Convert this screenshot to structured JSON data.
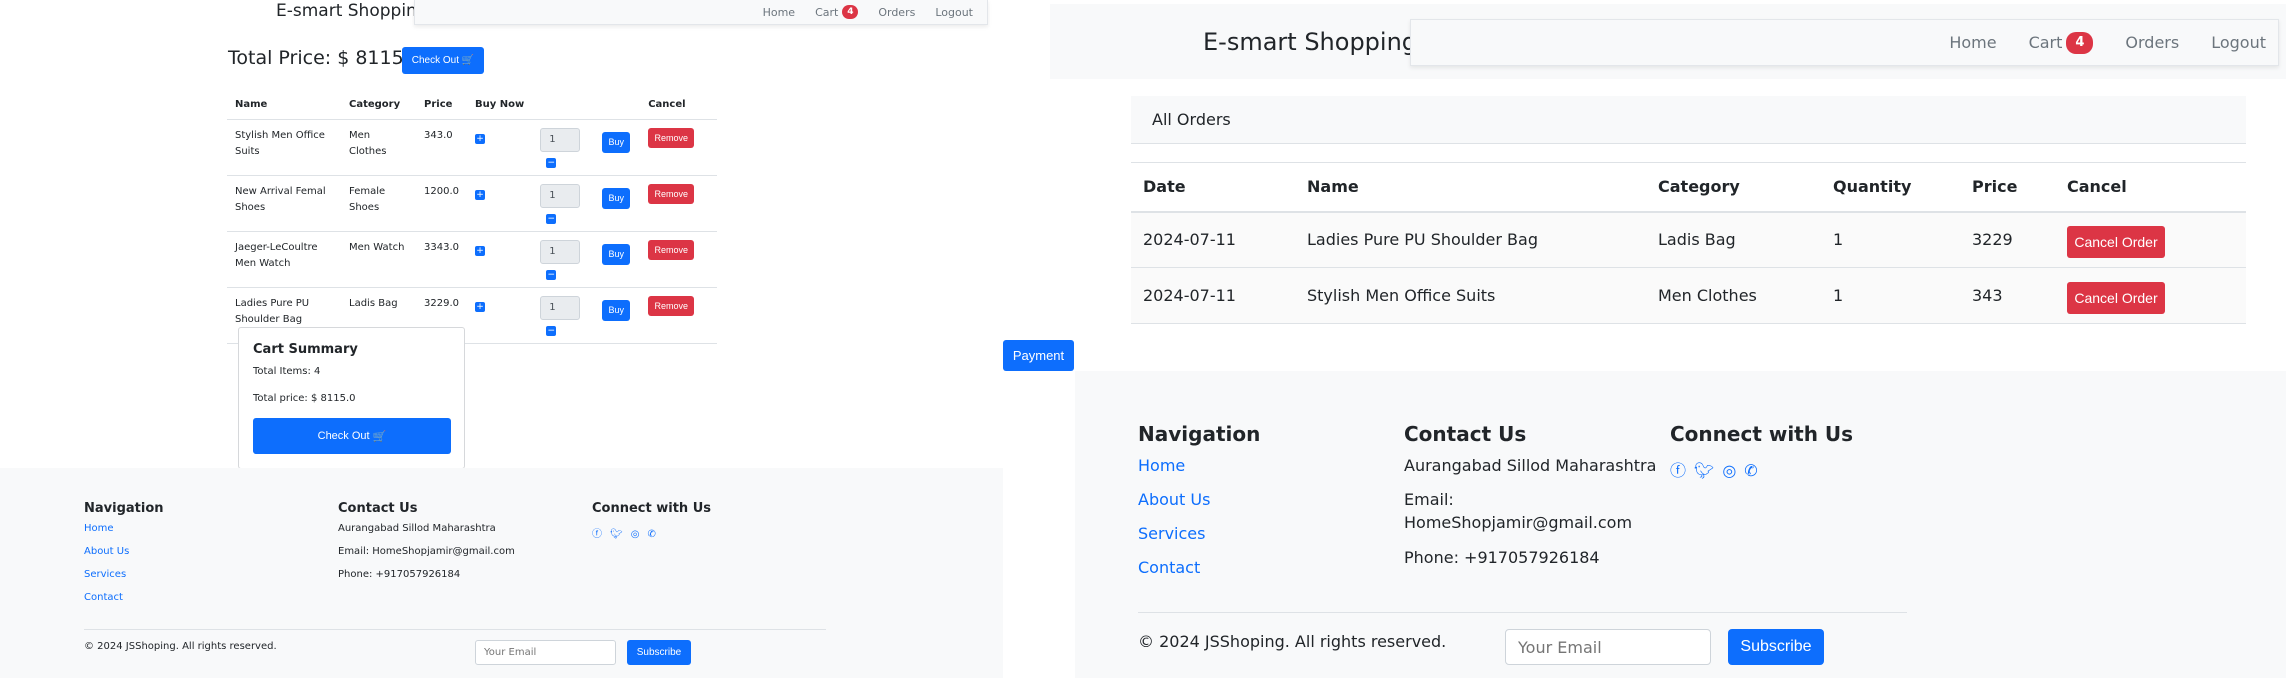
{
  "left": {
    "brand": "E-smart Shopping",
    "nav": [
      {
        "label": "Home"
      },
      {
        "label": "Cart",
        "badge": "4"
      },
      {
        "label": "Orders"
      },
      {
        "label": "Logout"
      }
    ],
    "total_price": "Total Price: $ 8115.0",
    "checkout_label": "Check Out",
    "table": {
      "headers": [
        "Name",
        "Category",
        "Price",
        "Buy Now",
        "",
        "",
        "Cancel"
      ],
      "rows": [
        {
          "name": "Stylish Men Office Suits",
          "category": "Men Clothes",
          "price": "343.0",
          "qty": "1",
          "buy": "Buy",
          "remove": "Remove"
        },
        {
          "name": "New Arrival Femal Shoes",
          "category": "Female Shoes",
          "price": "1200.0",
          "qty": "1",
          "buy": "Buy",
          "remove": "Remove"
        },
        {
          "name": "Jaeger-LeCoultre Men Watch",
          "category": "Men Watch",
          "price": "3343.0",
          "qty": "1",
          "buy": "Buy",
          "remove": "Remove"
        },
        {
          "name": "Ladies Pure PU Shoulder Bag",
          "category": "Ladis Bag",
          "price": "3229.0",
          "qty": "1",
          "buy": "Buy",
          "remove": "Remove"
        }
      ]
    },
    "summary": {
      "title": "Cart Summary",
      "items": "Total Items: 4",
      "price": "Total price: $ 8115.0",
      "checkout_label": "Check Out"
    },
    "footer": {
      "nav_title": "Navigation",
      "nav_links": [
        "Home",
        "About Us",
        "Services",
        "Contact"
      ],
      "contact_title": "Contact Us",
      "address": "Aurangabad Sillod Maharashtra",
      "email": "Email: HomeShopjamir@gmail.com",
      "phone": "Phone: +917057926184",
      "connect_title": "Connect with Us",
      "social_icons": [
        "facebook-icon",
        "twitter-icon",
        "instagram-icon",
        "whatsapp-icon"
      ],
      "copyright": "© 2024 JSShoping. All rights reserved.",
      "email_placeholder": "Your Email",
      "subscribe_label": "Subscribe"
    }
  },
  "payment_label": "Payment",
  "right": {
    "brand": "E-smart Shopping",
    "nav": [
      {
        "label": "Home"
      },
      {
        "label": "Cart",
        "badge": "4"
      },
      {
        "label": "Orders"
      },
      {
        "label": "Logout"
      }
    ],
    "orders_title": "All Orders",
    "table": {
      "headers": [
        "Date",
        "Name",
        "Category",
        "Quantity",
        "Price",
        "Cancel"
      ],
      "rows": [
        {
          "date": "2024-07-11",
          "name": "Ladies Pure PU Shoulder Bag",
          "category": "Ladis Bag",
          "quantity": "1",
          "price": "3229",
          "cancel": "Cancel Order"
        },
        {
          "date": "2024-07-11",
          "name": "Stylish Men Office Suits",
          "category": "Men Clothes",
          "quantity": "1",
          "price": "343",
          "cancel": "Cancel Order"
        }
      ]
    },
    "footer": {
      "nav_title": "Navigation",
      "nav_links": [
        "Home",
        "About Us",
        "Services",
        "Contact"
      ],
      "contact_title": "Contact Us",
      "address": "Aurangabad Sillod Maharashtra",
      "email_line1": "Email:",
      "email_line2": "HomeShopjamir@gmail.com",
      "phone": "Phone: +917057926184",
      "connect_title": "Connect with Us",
      "social_icons": [
        "facebook-icon",
        "twitter-icon",
        "instagram-icon",
        "whatsapp-icon"
      ],
      "copyright": "© 2024 JSShoping. All rights reserved.",
      "email_placeholder": "Your Email",
      "subscribe_label": "Subscribe"
    }
  },
  "colors": {
    "primary": "#0d6efd",
    "danger": "#dc3545",
    "light_bg": "#f8f9fa"
  }
}
